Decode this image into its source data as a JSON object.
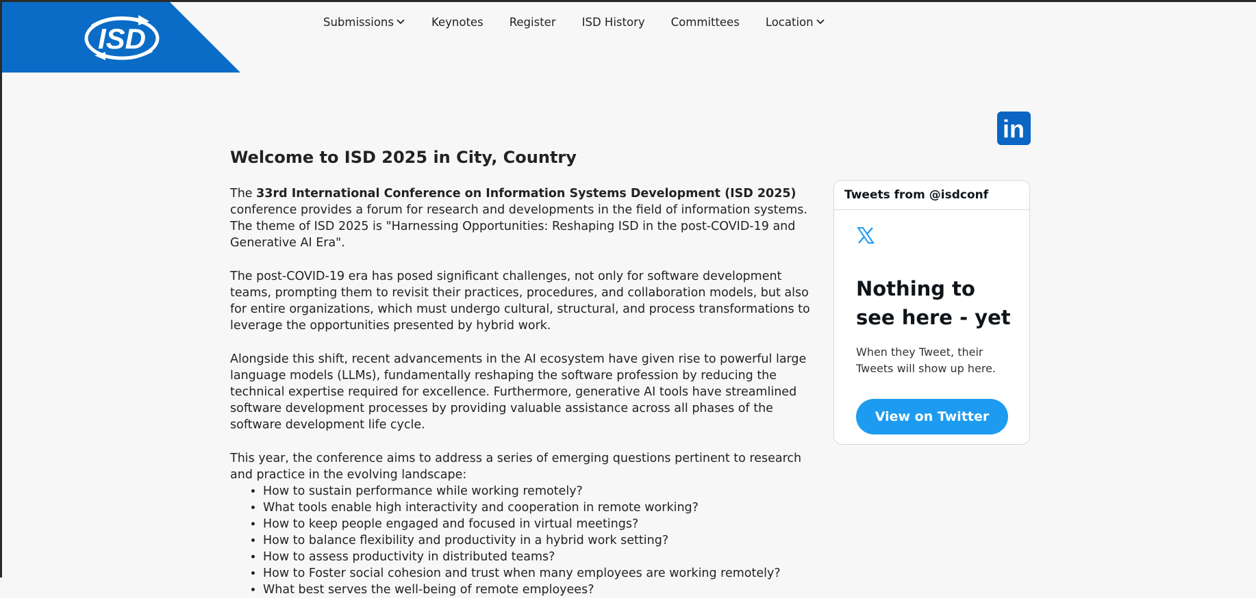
{
  "colors": {
    "brand_blue": "#0a6cc6",
    "linkedin_blue": "#0a66c2",
    "twitter_blue": "#1d9bf0",
    "page_background": "#f7f7f7"
  },
  "logo": {
    "icon": "isd-logo",
    "text": "ISD"
  },
  "nav": {
    "submissions": "Submissions",
    "keynotes": "Keynotes",
    "register": "Register",
    "isd_history": "ISD History",
    "committees": "Committees",
    "location": "Location",
    "dropdown_icon": "chevron-down-icon"
  },
  "social": {
    "linkedin_icon": "linkedin-icon",
    "linkedin_text": "in"
  },
  "main": {
    "title": "Welcome to ISD 2025 in City, Country",
    "intro_lead": "The ",
    "intro_bold": "33rd International Conference on Information Systems Development (ISD 2025)",
    "intro_rest": " conference provides a forum for research and developments in the field of information systems. The theme of ISD 2025 is \"Harnessing Opportunities: Reshaping ISD in the post-COVID-19 and Generative AI Era\".",
    "paragraph_2": "The post-COVID-19 era has posed significant challenges, not only for software development teams, prompting them to revisit their practices, procedures, and collaboration models, but also for entire organizations, which must undergo cultural, structural, and process transformations to leverage the opportunities presented by hybrid work.",
    "paragraph_3": "Alongside this shift, recent advancements in the AI ecosystem have given rise to powerful large language models (LLMs), fundamentally reshaping the software profession by reducing the technical expertise required for excellence. Furthermore, generative AI tools have streamlined software development processes by providing valuable assistance across all phases of the software development life cycle.",
    "paragraph_4": "This year, the conference aims to address a series of emerging questions pertinent to research and practice in the evolving landscape:",
    "questions": [
      "How to sustain performance while working remotely?",
      "What tools enable high interactivity and cooperation in remote working?",
      "How to keep people engaged and focused in virtual meetings?",
      "How to balance flexibility and productivity in a hybrid work setting?",
      "How to assess productivity in distributed teams?",
      "How to Foster social cohesion and trust when many employees are working remotely?",
      "What best serves the well-being of remote employees?"
    ]
  },
  "twitter_widget": {
    "header": "Tweets from @isdconf",
    "x_icon": "x-logo-icon",
    "empty_title": "Nothing to see here - yet",
    "empty_text": "When they Tweet, their Tweets will show up here.",
    "button_label": "View on Twitter"
  }
}
